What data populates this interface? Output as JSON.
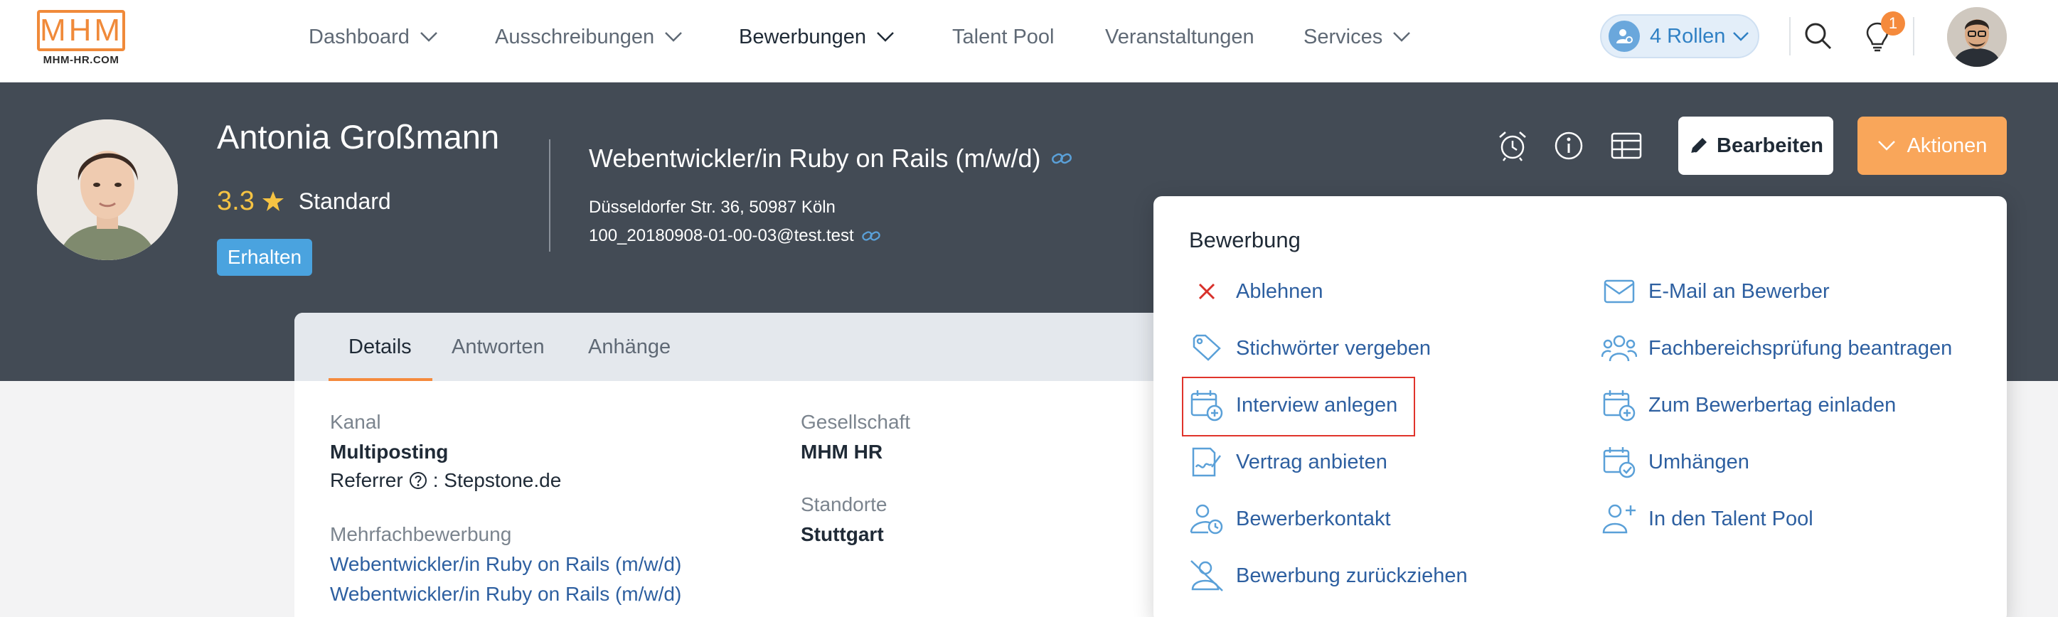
{
  "brand": {
    "logo_text": "MHM",
    "logo_sub": "MHM-HR.COM",
    "accent": "#f58a3c"
  },
  "nav": {
    "items": [
      {
        "label": "Dashboard",
        "has_dropdown": true
      },
      {
        "label": "Ausschreibungen",
        "has_dropdown": true
      },
      {
        "label": "Bewerbungen",
        "has_dropdown": true,
        "active": true
      },
      {
        "label": "Talent Pool",
        "has_dropdown": false
      },
      {
        "label": "Veranstaltungen",
        "has_dropdown": false
      },
      {
        "label": "Services",
        "has_dropdown": true
      }
    ],
    "roles_label": "4 Rollen",
    "notification_count": "1"
  },
  "candidate": {
    "name": "Antonia Großmann",
    "rating": "3.3",
    "rating_label": "Standard",
    "status": "Erhalten"
  },
  "job": {
    "title": "Webentwickler/in Ruby on Rails (m/w/d)",
    "address": "Düsseldorfer Str. 36, 50987 Köln",
    "email": "100_20180908-01-00-03@test.test"
  },
  "header_actions": {
    "edit_label": "Bearbeiten",
    "actions_label": "Aktionen",
    "icons": [
      "alarm-clock-icon",
      "info-icon",
      "table-icon"
    ]
  },
  "tabs": [
    {
      "label": "Details",
      "active": true
    },
    {
      "label": "Antworten"
    },
    {
      "label": "Anhänge"
    }
  ],
  "details": {
    "kanal_label": "Kanal",
    "kanal_value": "Multiposting",
    "referrer_label": "Referrer",
    "referrer_value": ": Stepstone.de",
    "mehrfach_label": "Mehrfachbewerbung",
    "mehrfach_links": [
      "Webentwickler/in Ruby on Rails (m/w/d)",
      "Webentwickler/in Ruby on Rails (m/w/d)"
    ],
    "gesellschaft_label": "Gesellschaft",
    "gesellschaft_value": "MHM HR",
    "standorte_label": "Standorte",
    "standorte_value": "Stuttgart"
  },
  "actions_menu": {
    "title": "Bewerbung",
    "left": [
      {
        "label": "Ablehnen",
        "icon": "x-icon"
      },
      {
        "label": "Stichwörter vergeben",
        "icon": "tag-icon"
      },
      {
        "label": "Interview anlegen",
        "icon": "calendar-plus-icon",
        "highlighted": true
      },
      {
        "label": "Vertrag anbieten",
        "icon": "contract-icon"
      },
      {
        "label": "Bewerberkontakt",
        "icon": "user-clock-icon"
      },
      {
        "label": "Bewerbung zurückziehen",
        "icon": "user-slash-icon"
      }
    ],
    "right": [
      {
        "label": "E-Mail an Bewerber",
        "icon": "envelope-icon"
      },
      {
        "label": "Fachbereichsprüfung beantragen",
        "icon": "users-icon"
      },
      {
        "label": "Zum Bewerbertag einladen",
        "icon": "calendar-plus-icon"
      },
      {
        "label": "Umhängen",
        "icon": "calendar-check-icon"
      },
      {
        "label": "In den Talent Pool",
        "icon": "user-plus-icon"
      }
    ]
  }
}
